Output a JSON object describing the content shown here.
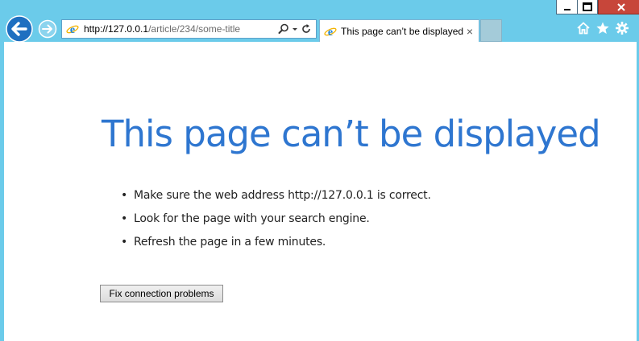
{
  "window": {
    "minimize_icon": "minimize-icon",
    "maximize_icon": "maximize-icon",
    "close_icon": "close-icon",
    "close_glyph": "✕",
    "close_color": "#c7463a"
  },
  "toolbar": {
    "back_icon": "back-arrow-icon",
    "forward_icon": "forward-arrow-icon",
    "address": {
      "host": "http://127.0.0.1",
      "path": "/article/234/some-title"
    },
    "search_icon": "search-icon",
    "dropdown_icon": "chevron-down-icon",
    "refresh_icon": "refresh-icon"
  },
  "tab": {
    "label": "This page can’t be displayed",
    "close_glyph": "×"
  },
  "right_tools": [
    "home-icon",
    "favorites-star-icon",
    "gear-icon"
  ],
  "page": {
    "title": "This page can’t be displayed",
    "tips": [
      "Make sure the web address http://127.0.0.1 is correct.",
      "Look for the page with your search engine.",
      "Refresh the page in a few minutes."
    ],
    "fix_button_label": "Fix connection problems"
  },
  "colors": {
    "frame": "#6bcbea",
    "title": "#2e76d0"
  }
}
